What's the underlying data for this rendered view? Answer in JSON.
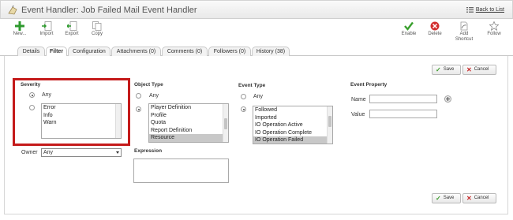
{
  "window": {
    "title": "Event Handler: Job Failed Mail Event Handler",
    "back_label": "Back to List"
  },
  "toolbar": {
    "left": [
      {
        "label": "New...",
        "icon": "plus-icon"
      },
      {
        "label": "Import",
        "icon": "import-icon"
      },
      {
        "label": "Export",
        "icon": "export-icon"
      },
      {
        "label": "Copy",
        "icon": "copy-icon"
      }
    ],
    "enable_label": "Enable",
    "delete_label": "Delete",
    "add_shortcut_label": "Add Shortcut",
    "follow_label": "Follow"
  },
  "tabs": [
    "Details",
    "Filter",
    "Configuration",
    "Attachments (0)",
    "Comments (0)",
    "Followers (0)",
    "History (38)"
  ],
  "active_tab": "Filter",
  "buttons": {
    "save": "Save",
    "cancel": "Cancel"
  },
  "severity": {
    "label": "Severity",
    "any": "Any",
    "items": [
      "Error",
      "Info",
      "Warn"
    ]
  },
  "owner": {
    "label": "Owner",
    "value": "Any"
  },
  "object_type": {
    "label": "Object Type",
    "any": "Any",
    "items": [
      "Player Definition",
      "Profile",
      "Quota",
      "Report Definition",
      "Resource"
    ],
    "selected_index": 4
  },
  "expression": {
    "label": "Expression",
    "value": ""
  },
  "event_type": {
    "label": "Event Type",
    "any": "Any",
    "items": [
      "Followed",
      "Imported",
      "IO Operation Active",
      "IO Operation Complete",
      "IO Operation Failed"
    ],
    "selected_index": 4
  },
  "event_property": {
    "label": "Event Property",
    "name_label": "Name",
    "value_label": "Value",
    "name_value": "",
    "value_value": ""
  }
}
